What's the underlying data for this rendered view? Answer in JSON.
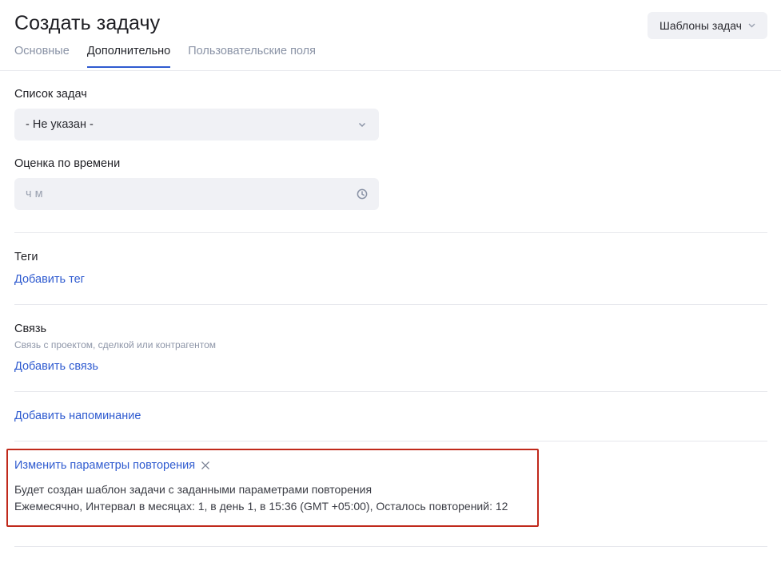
{
  "header": {
    "title": "Создать задачу",
    "templates_button": "Шаблоны задач"
  },
  "tabs": [
    {
      "label": "Основные",
      "active": false
    },
    {
      "label": "Дополнительно",
      "active": true
    },
    {
      "label": "Пользовательские поля",
      "active": false
    }
  ],
  "task_list": {
    "label": "Список задач",
    "selected": "- Не указан -"
  },
  "time_estimate": {
    "label": "Оценка по времени",
    "placeholder": "ч м"
  },
  "tags": {
    "label": "Теги",
    "add_link": "Добавить тег"
  },
  "link": {
    "label": "Связь",
    "hint": "Связь с проектом, сделкой или контрагентом",
    "add_link": "Добавить связь"
  },
  "reminder": {
    "add_link": "Добавить напоминание"
  },
  "repeat": {
    "edit_link": "Изменить параметры повторения",
    "description": "Будет создан шаблон задачи с заданными параметрами повторения",
    "schedule": "Ежемесячно, Интервал в месяцах: 1, в день 1, в 15:36 (GMT +05:00), Осталось повторений: 12"
  },
  "colors": {
    "accent": "#2f5bd0",
    "highlight_border": "#c0291b",
    "field_bg": "#f0f1f5"
  }
}
